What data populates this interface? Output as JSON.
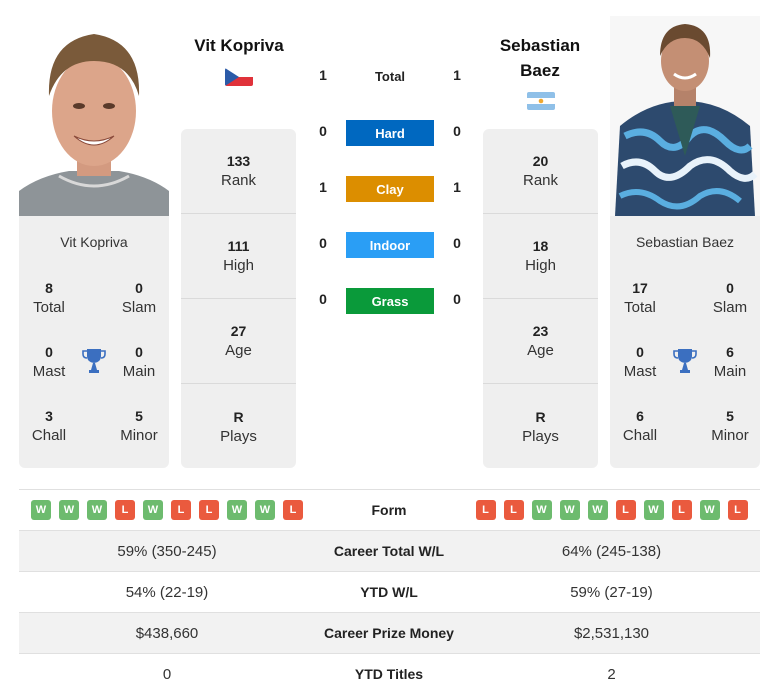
{
  "players": {
    "left": {
      "name": "Vit Kopriva",
      "flag_icon": "czech-flag-icon",
      "stats": [
        {
          "value": "133",
          "label": "Rank"
        },
        {
          "value": "111",
          "label": "High"
        },
        {
          "value": "27",
          "label": "Age"
        },
        {
          "value": "R",
          "label": "Plays"
        }
      ],
      "titles": {
        "name": "Vit Kopriva",
        "total": {
          "value": "8",
          "label": "Total"
        },
        "slam": {
          "value": "0",
          "label": "Slam"
        },
        "mast": {
          "value": "0",
          "label": "Mast"
        },
        "main": {
          "value": "0",
          "label": "Main"
        },
        "chall": {
          "value": "3",
          "label": "Chall"
        },
        "minor": {
          "value": "5",
          "label": "Minor"
        }
      },
      "form": [
        "W",
        "W",
        "W",
        "L",
        "W",
        "L",
        "L",
        "W",
        "W",
        "L"
      ]
    },
    "right": {
      "name": "Sebastian Baez",
      "flag_icon": "argentina-flag-icon",
      "stats": [
        {
          "value": "20",
          "label": "Rank"
        },
        {
          "value": "18",
          "label": "High"
        },
        {
          "value": "23",
          "label": "Age"
        },
        {
          "value": "R",
          "label": "Plays"
        }
      ],
      "titles": {
        "name": "Sebastian Baez",
        "total": {
          "value": "17",
          "label": "Total"
        },
        "slam": {
          "value": "0",
          "label": "Slam"
        },
        "mast": {
          "value": "0",
          "label": "Mast"
        },
        "main": {
          "value": "6",
          "label": "Main"
        },
        "chall": {
          "value": "6",
          "label": "Chall"
        },
        "minor": {
          "value": "5",
          "label": "Minor"
        }
      },
      "form": [
        "L",
        "L",
        "W",
        "W",
        "W",
        "L",
        "W",
        "L",
        "W",
        "L"
      ]
    }
  },
  "h2h": {
    "total": {
      "label": "Total",
      "left": "1",
      "right": "1"
    },
    "surfaces": [
      {
        "label": "Hard",
        "left": "0",
        "right": "0",
        "color": "#0068c0"
      },
      {
        "label": "Clay",
        "left": "1",
        "right": "1",
        "color": "#dc8e00"
      },
      {
        "label": "Indoor",
        "left": "0",
        "right": "0",
        "color": "#2a9ef5"
      },
      {
        "label": "Grass",
        "left": "0",
        "right": "0",
        "color": "#0a9a3a"
      }
    ]
  },
  "table": {
    "form_label": "Form",
    "rows": [
      {
        "label": "Career Total W/L",
        "left": "59% (350-245)",
        "right": "64% (245-138)"
      },
      {
        "label": "YTD W/L",
        "left": "54% (22-19)",
        "right": "59% (27-19)"
      },
      {
        "label": "Career Prize Money",
        "left": "$438,660",
        "right": "$2,531,130"
      },
      {
        "label": "YTD Titles",
        "left": "0",
        "right": "2"
      }
    ]
  },
  "colors": {
    "win": "#6dbb6e",
    "loss": "#ea5a3e",
    "trophy": "#3b6fc0"
  }
}
